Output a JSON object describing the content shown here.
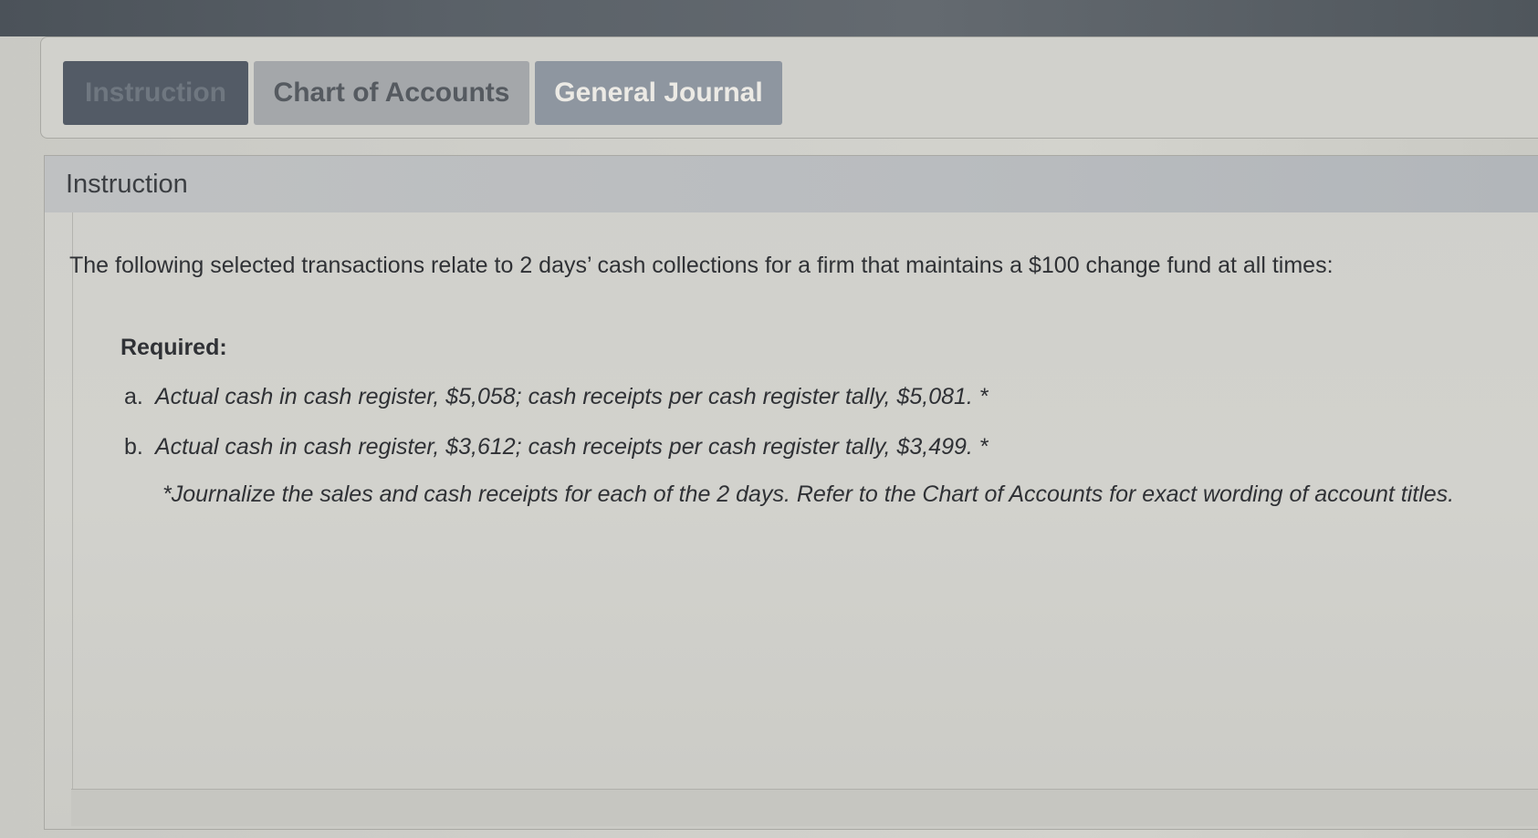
{
  "tabs": [
    {
      "label": "Instruction",
      "active": true
    },
    {
      "label": "Chart of Accounts",
      "active": false
    },
    {
      "label": "General Journal",
      "active": false
    }
  ],
  "panel": {
    "title": "Instruction",
    "intro": "The following selected transactions relate to 2 days’ cash collections for a firm that maintains a $100 change fund at all times:",
    "required_label": "Required:",
    "items": [
      {
        "marker": "a.",
        "text": "Actual cash in cash register, $5,058; cash receipts per cash register tally, $5,081. *"
      },
      {
        "marker": "b.",
        "text": "Actual cash in cash register, $3,612; cash receipts per cash register tally, $3,499. *"
      }
    ],
    "note": "*Journalize the sales and cash receipts for each of the 2 days. Refer to the Chart of Accounts for exact wording of account titles."
  },
  "colors": {
    "active_tab": "#535b66",
    "inactive_tab": "#a4a7aa",
    "journal_tab": "#8e96a0",
    "header_bar": "#b9bcbf"
  }
}
